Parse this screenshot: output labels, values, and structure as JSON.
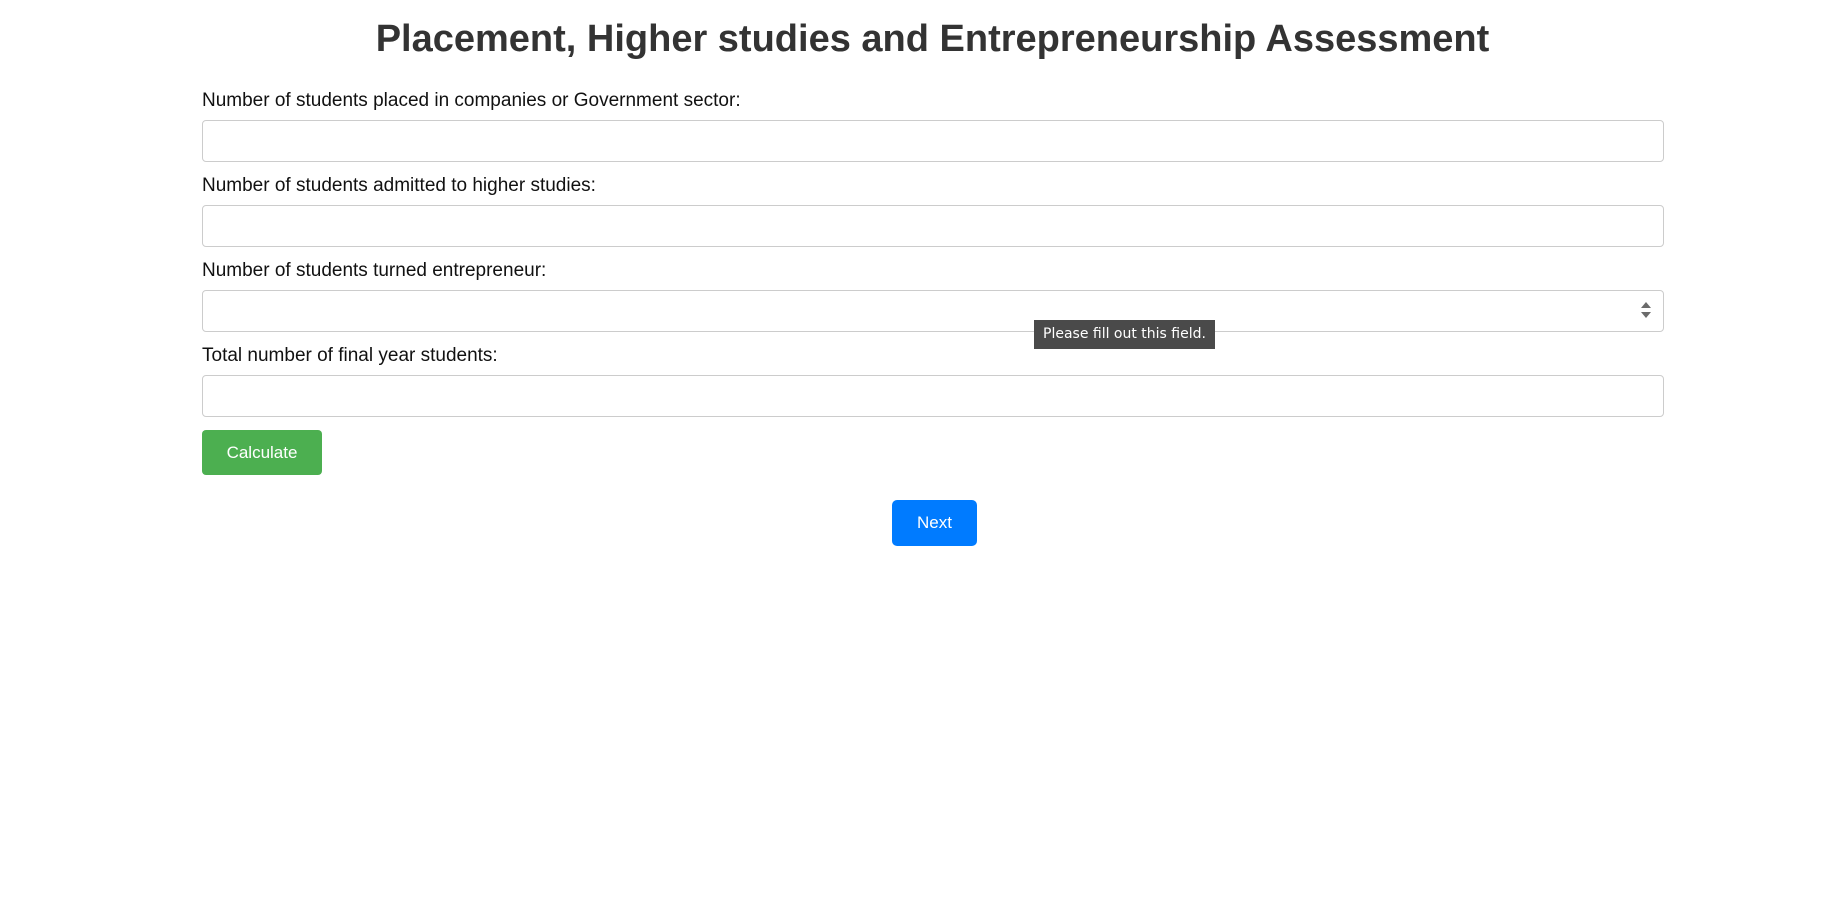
{
  "page": {
    "title": "Placement, Higher studies and Entrepreneurship Assessment"
  },
  "form": {
    "fields": [
      {
        "label": "Number of students placed in companies or Government sector:",
        "value": "",
        "placeholder": ""
      },
      {
        "label": "Number of students admitted to higher studies:",
        "value": "",
        "placeholder": ""
      },
      {
        "label": "Number of students turned entrepreneur:",
        "value": "",
        "placeholder": ""
      },
      {
        "label": "Total number of final year students:",
        "value": "",
        "placeholder": ""
      }
    ],
    "validation_tooltip": "Please fill out this field.",
    "calculate_label": "Calculate",
    "next_label": "Next"
  },
  "colors": {
    "title": "#333333",
    "calculate_button": "#4caf50",
    "next_button": "#007bff",
    "tooltip_background": "#4a4a4a",
    "input_border": "#cccccc"
  }
}
